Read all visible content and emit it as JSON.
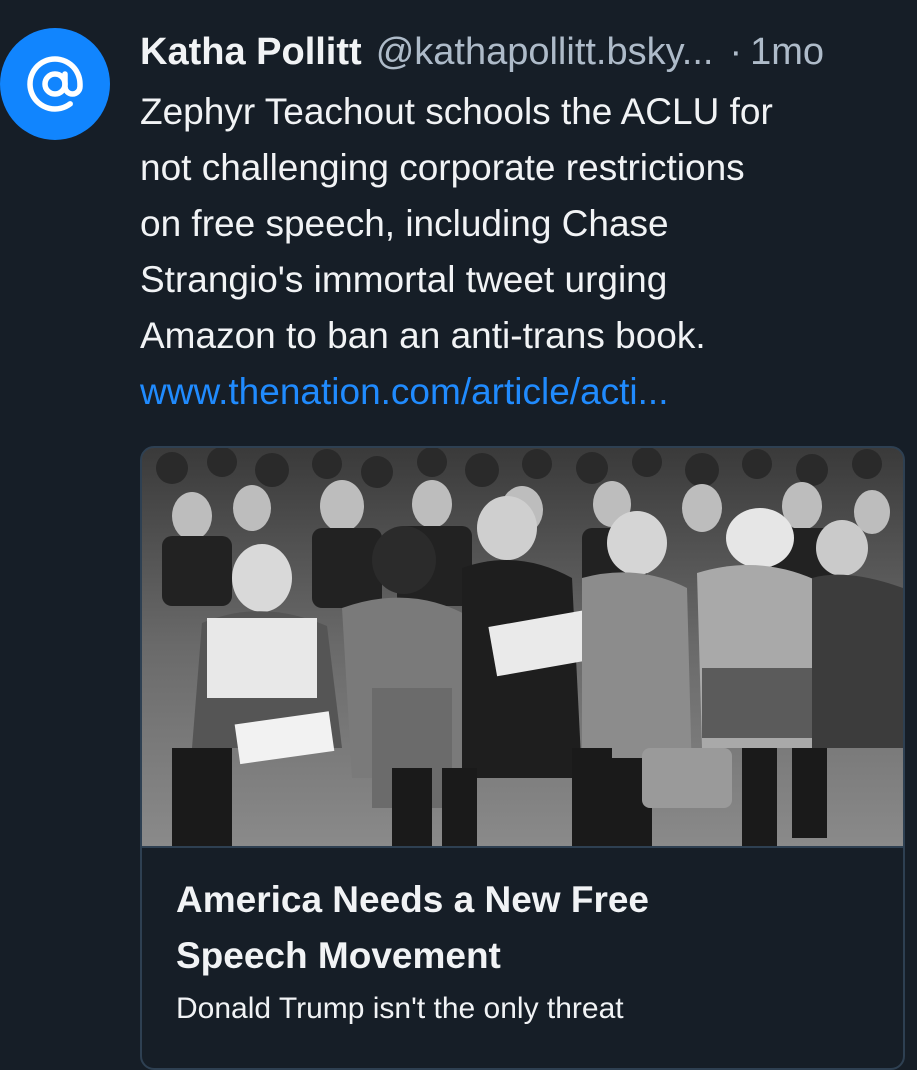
{
  "post": {
    "author": {
      "display_name": "Katha Pollitt",
      "handle": "@kathapollitt.bsky...",
      "avatar_icon": "at-sign-icon",
      "avatar_color": "#1185fe"
    },
    "separator": "·",
    "timestamp": "1mo",
    "text_lines": [
      "Zephyr Teachout schools the ACLU for",
      "not challenging corporate restrictions",
      "on free speech, including Chase",
      "Strangio's immortal tweet urging",
      "Amazon to ban an anti-trans book."
    ],
    "link_text": "www.thenation.com/article/acti...",
    "link_color": "#208bfe"
  },
  "embed_card": {
    "image_icon": "black-and-white-photo-of-seated-audience",
    "title_lines": [
      "America Needs a New Free",
      "Speech Movement"
    ],
    "description": "Donald Trump isn't the only threat"
  },
  "colors": {
    "background": "#161e27",
    "card_border": "#2e4052",
    "text_primary": "#f1f3f5",
    "text_secondary": "#aebbc9"
  }
}
